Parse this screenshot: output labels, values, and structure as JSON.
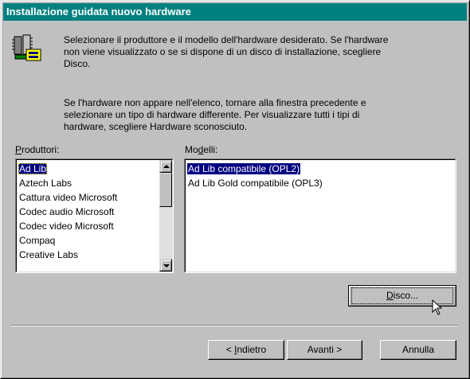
{
  "window": {
    "title": "Installazione guidata nuovo hardware"
  },
  "intro": {
    "paragraph1": [
      "Selezionare il produttore e il modello dell'hardware desiderato. Se l'hardware",
      "non viene visualizzato o se si dispone di un disco di installazione, scegliere",
      "Disco."
    ],
    "paragraph2": [
      "Se l'hardware non appare nell'elenco, tornare alla finestra precedente e",
      "selezionare un tipo di hardware differente. Per visualizzare tutti i tipi di",
      "hardware, scegliere Hardware sconosciuto."
    ],
    "icon": "hardware-chips-icon"
  },
  "manufacturers": {
    "label_hot": "P",
    "label_rest": "roduttori:",
    "selected": "Ad Lib",
    "items": [
      "Ad Lib",
      "Aztech Labs",
      "Cattura video Microsoft",
      "Codec audio Microsoft",
      "Codec video Microsoft",
      "Compaq",
      "Creative Labs"
    ]
  },
  "models": {
    "label_pre": "Mo",
    "label_hot": "d",
    "label_rest": "elli:",
    "selected": "Ad Lib compatibile (OPL2)",
    "items": [
      "Ad Lib compatibile (OPL2)",
      "Ad Lib Gold compatibile (OPL3)"
    ]
  },
  "buttons": {
    "disk_hot": "D",
    "disk_rest": "isco...",
    "back_pre": "< ",
    "back_hot": "I",
    "back_rest": "ndietro",
    "next": "Avanti >",
    "cancel": "Annulla"
  },
  "colors": {
    "titlebar": "#008080",
    "face": "#c0c0c0",
    "selection": "#000080"
  }
}
